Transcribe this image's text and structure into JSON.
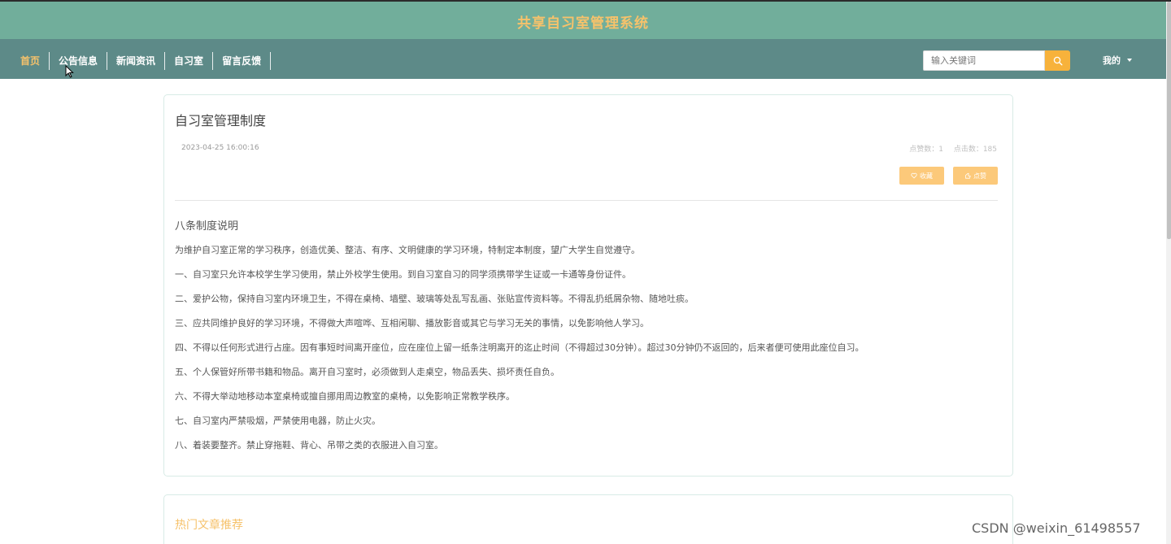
{
  "header": {
    "site_title": "共享自习室管理系统"
  },
  "nav": {
    "items": [
      {
        "label": "首页",
        "active": true
      },
      {
        "label": "公告信息",
        "active": false
      },
      {
        "label": "新闻资讯",
        "active": false
      },
      {
        "label": "自习室",
        "active": false
      },
      {
        "label": "留言反馈",
        "active": false
      }
    ],
    "search_placeholder": "输入关键词",
    "search_icon": "search-icon",
    "user_menu_label": "我的"
  },
  "article": {
    "title": "自习室管理制度",
    "date": "2023-04-25 16:00:16",
    "likes_text": "点赞数：1",
    "clicks_text": "点击数：185",
    "favorite_label": "收藏",
    "like_label": "点赞",
    "sub_heading": "八条制度说明",
    "paragraphs": [
      "为维护自习室正常的学习秩序，创造优美、整洁、有序、文明健康的学习环境，特制定本制度，望广大学生自觉遵守。",
      "一、自习室只允许本校学生学习使用，禁止外校学生使用。到自习室自习的同学须携带学生证或一卡通等身份证件。",
      "二、爱护公物，保持自习室内环境卫生，不得在桌椅、墙壁、玻璃等处乱写乱画、张贴宣传资料等。不得乱扔纸屑杂物、随地吐痰。",
      "三、应共同维护良好的学习环境，不得做大声喧哗、互相闲聊、播放影音或其它与学习无关的事情，以免影响他人学习。",
      "四、不得以任何形式进行占座。因有事短时间离开座位，应在座位上留一纸条注明离开的迄止时间（不得超过30分钟）。超过30分钟仍不返回的，后来者便可使用此座位自习。",
      "五、个人保管好所带书籍和物品。离开自习室时，必须做到人走桌空，物品丢失、损坏责任自负。",
      "六、不得大举动地移动本室桌椅或擅自挪用周边教室的桌椅，以免影响正常教学秩序。",
      "七、自习室内严禁吸烟，严禁使用电器，防止火灾。",
      "八、着装要整齐。禁止穿拖鞋、背心、吊带之类的衣服进入自习室。"
    ]
  },
  "hot": {
    "title": "热门文章推荐"
  },
  "watermark": "CSDN @weixin_61498557",
  "colors": {
    "header_bg": "#71ae9b",
    "nav_bg": "#5d8a88",
    "accent": "#f6c26b",
    "search_button": "#f7b23b",
    "action_button": "#fcc97a"
  }
}
